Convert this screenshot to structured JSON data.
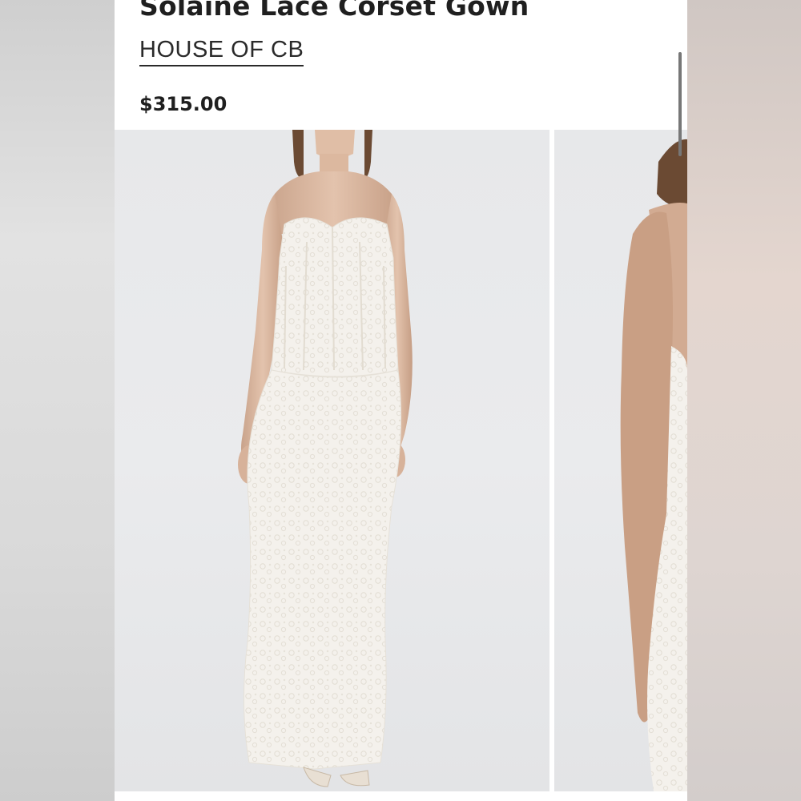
{
  "product": {
    "title": "Solaine Lace Corset Gown",
    "brand": "HOUSE OF CB",
    "price": "$315.00"
  },
  "gallery": {
    "images": [
      {
        "name": "front view model wearing white strapless lace corset gown"
      },
      {
        "name": "side view model wearing white lace gown"
      }
    ]
  },
  "colors": {
    "text": "#1f1f1f",
    "background": "#ffffff",
    "photo_backdrop": "#e8e9eb",
    "gown": "#f6f3ee"
  }
}
